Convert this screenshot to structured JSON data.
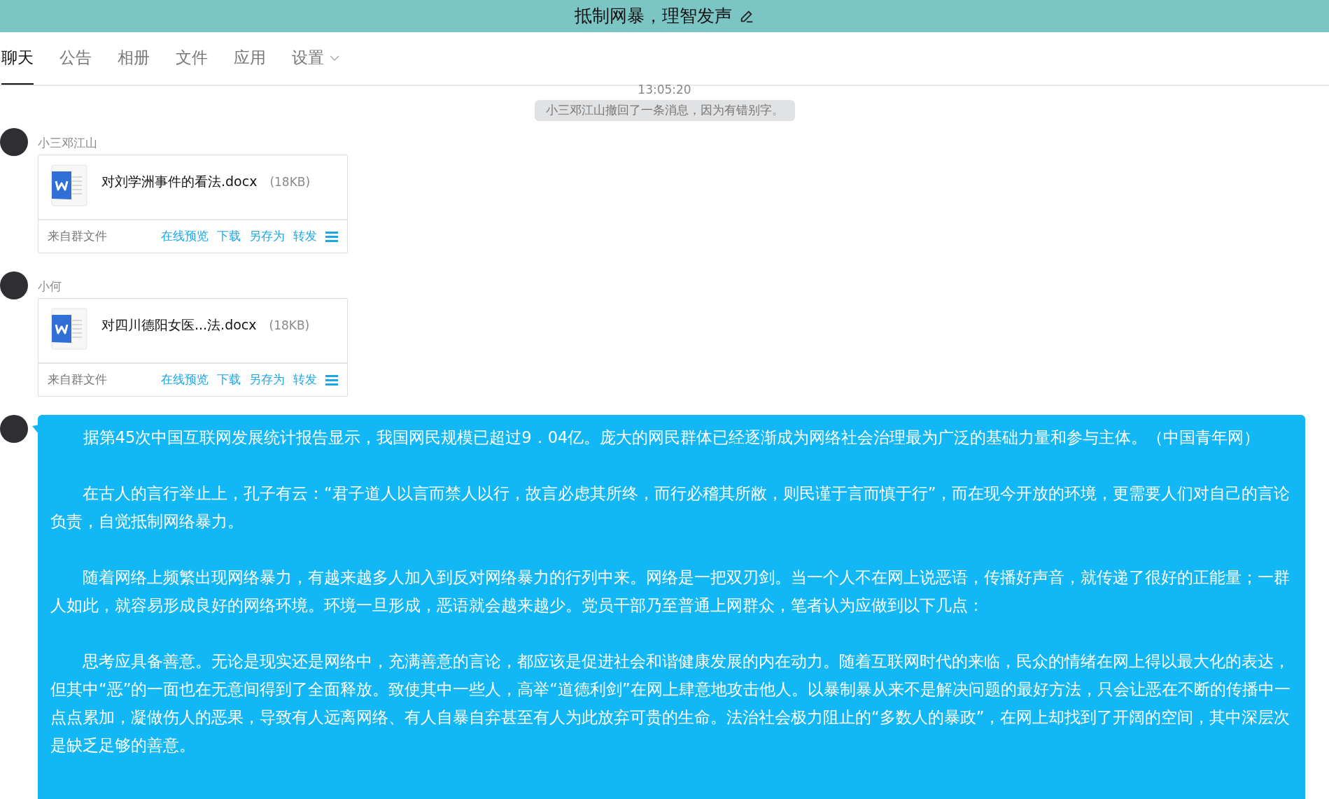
{
  "header": {
    "title": "抵制网暴，理智发声"
  },
  "tabs": [
    {
      "label": "聊天",
      "selected": true
    },
    {
      "label": "公告",
      "selected": false
    },
    {
      "label": "相册",
      "selected": false
    },
    {
      "label": "文件",
      "selected": false
    },
    {
      "label": "应用",
      "selected": false
    },
    {
      "label": "设置",
      "selected": false,
      "dropdown": true
    }
  ],
  "timestamp": "13:05:20",
  "system_notice": "小三邓江山撤回了一条消息，因为有错别字。",
  "messages": [
    {
      "kind": "file",
      "sender": "小三邓江山",
      "file_name": "对刘学洲事件的看法.docx",
      "file_size": "(18KB)",
      "source": "来自群文件",
      "actions": [
        "在线预览",
        "下载",
        "另存为",
        "转发"
      ]
    },
    {
      "kind": "file",
      "sender": "小何",
      "file_name": "对四川德阳女医...法.docx",
      "file_size": "(18KB)",
      "source": "来自群文件",
      "actions": [
        "在线预览",
        "下载",
        "另存为",
        "转发"
      ]
    },
    {
      "kind": "text",
      "paragraphs": [
        {
          "centered": true,
          "text": "据第45次中国互联网发展统计报告显示，我国网民规模已超过9．04亿。庞大的网民群体已经逐渐成为网络社会治理最为广泛的基础力量和参与主体。（中国青年网）"
        },
        {
          "centered": false,
          "text": "　　在古人的言行举止上，孔子有云：“君子道人以言而禁人以行，故言必虑其所终，而行必稽其所敝，则民谨于言而慎于行”，而在现今开放的环境，更需要人们对自己的言论负责，自觉抵制网络暴力。"
        },
        {
          "centered": false,
          "text": "　　随着网络上频繁出现网络暴力，有越来越多人加入到反对网络暴力的行列中来。网络是一把双刃剑。当一个人不在网上说恶语，传播好声音，就传递了很好的正能量；一群人如此，就容易形成良好的网络环境。环境一旦形成，恶语就会越来越少。党员干部乃至普通上网群众，笔者认为应做到以下几点："
        },
        {
          "centered": false,
          "text": "　　思考应具备善意。无论是现实还是网络中，充满善意的言论，都应该是促进社会和谐健康发展的内在动力。随着互联网时代的来临，民众的情绪在网上得以最大化的表达，但其中“恶”的一面也在无意间得到了全面释放。致使其中一些人，高举“道德利剑”在网上肆意地攻击他人。以暴制暴从来不是解决问题的最好方法，只会让恶在不断的传播中一点点累加，凝做伤人的恶果，导致有人远离网络、有人自暴自弃甚至有人为此放弃可贵的生命。法治社会极力阻止的“多数人的暴政”，在网上却找到了开阔的空间，其中深层次是缺乏足够的善意。"
        }
      ]
    }
  ]
}
